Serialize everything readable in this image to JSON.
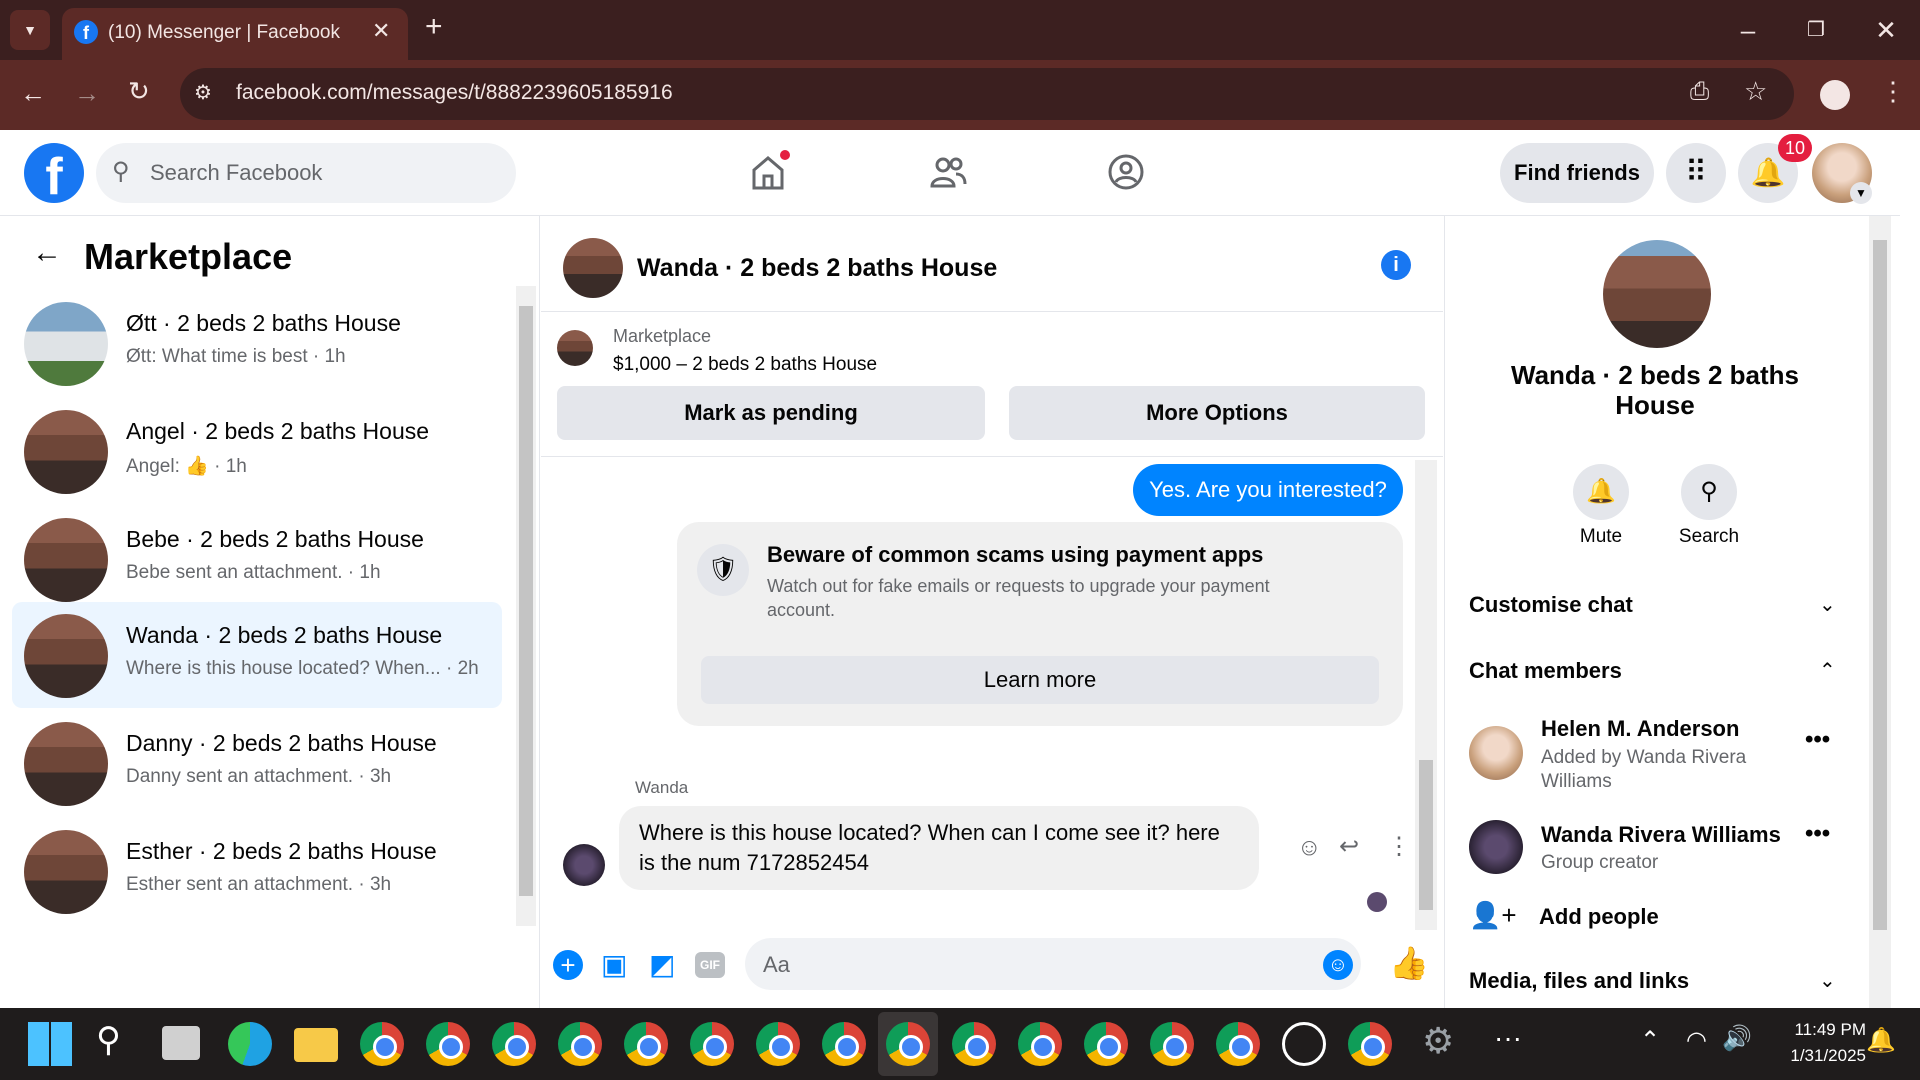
{
  "browser": {
    "tab_title": "(10) Messenger | Facebook",
    "url": "facebook.com/messages/t/8882239605185916"
  },
  "fb": {
    "search_placeholder": "Search Facebook",
    "find_friends": "Find friends",
    "notif_count": "10"
  },
  "left": {
    "title": "Marketplace",
    "conversations": [
      {
        "title": "Øtt · 2 beds 2 baths House",
        "preview": "Øtt: What time is best · 1h"
      },
      {
        "title": "Angel · 2 beds 2 baths House",
        "preview_prefix": "Angel:",
        "preview_suffix": "· 1h"
      },
      {
        "title": "Bebe · 2 beds 2 baths House",
        "preview": "Bebe sent an attachment. · 1h"
      },
      {
        "title": "Wanda · 2 beds 2 baths House",
        "preview": "Where is this house located? When... · 2h"
      },
      {
        "title": "Danny · 2 beds 2 baths House",
        "preview": "Danny sent an attachment. · 3h"
      },
      {
        "title": "Esther · 2 beds 2 baths House",
        "preview": "Esther sent an attachment. · 3h"
      }
    ]
  },
  "chat": {
    "title": "Wanda · 2 beds 2 baths House",
    "listing_label": "Marketplace",
    "listing_desc": "$1,000 – 2 beds 2 baths House",
    "mark_pending": "Mark as pending",
    "more_options": "More Options",
    "my_message": "Yes. Are you interested?",
    "scam_title": "Beware of common scams using payment apps",
    "scam_body": "Watch out for fake emails or requests to upgrade your payment account.",
    "learn_more": "Learn more",
    "sender_name": "Wanda",
    "their_message": "Where is this house located? When can I come see it? here is the num 7172852454",
    "input_placeholder": "Aa"
  },
  "info": {
    "title": "Wanda · 2 beds 2 baths House",
    "mute": "Mute",
    "search": "Search",
    "customise": "Customise chat",
    "members": "Chat members",
    "member1_name": "Helen M. Anderson",
    "member1_sub": "Added by Wanda Rivera Williams",
    "member2_name": "Wanda Rivera Williams",
    "member2_sub": "Group creator",
    "add_people": "Add people",
    "media": "Media, files and links"
  },
  "taskbar": {
    "time": "11:49 PM",
    "date": "1/31/2025"
  }
}
